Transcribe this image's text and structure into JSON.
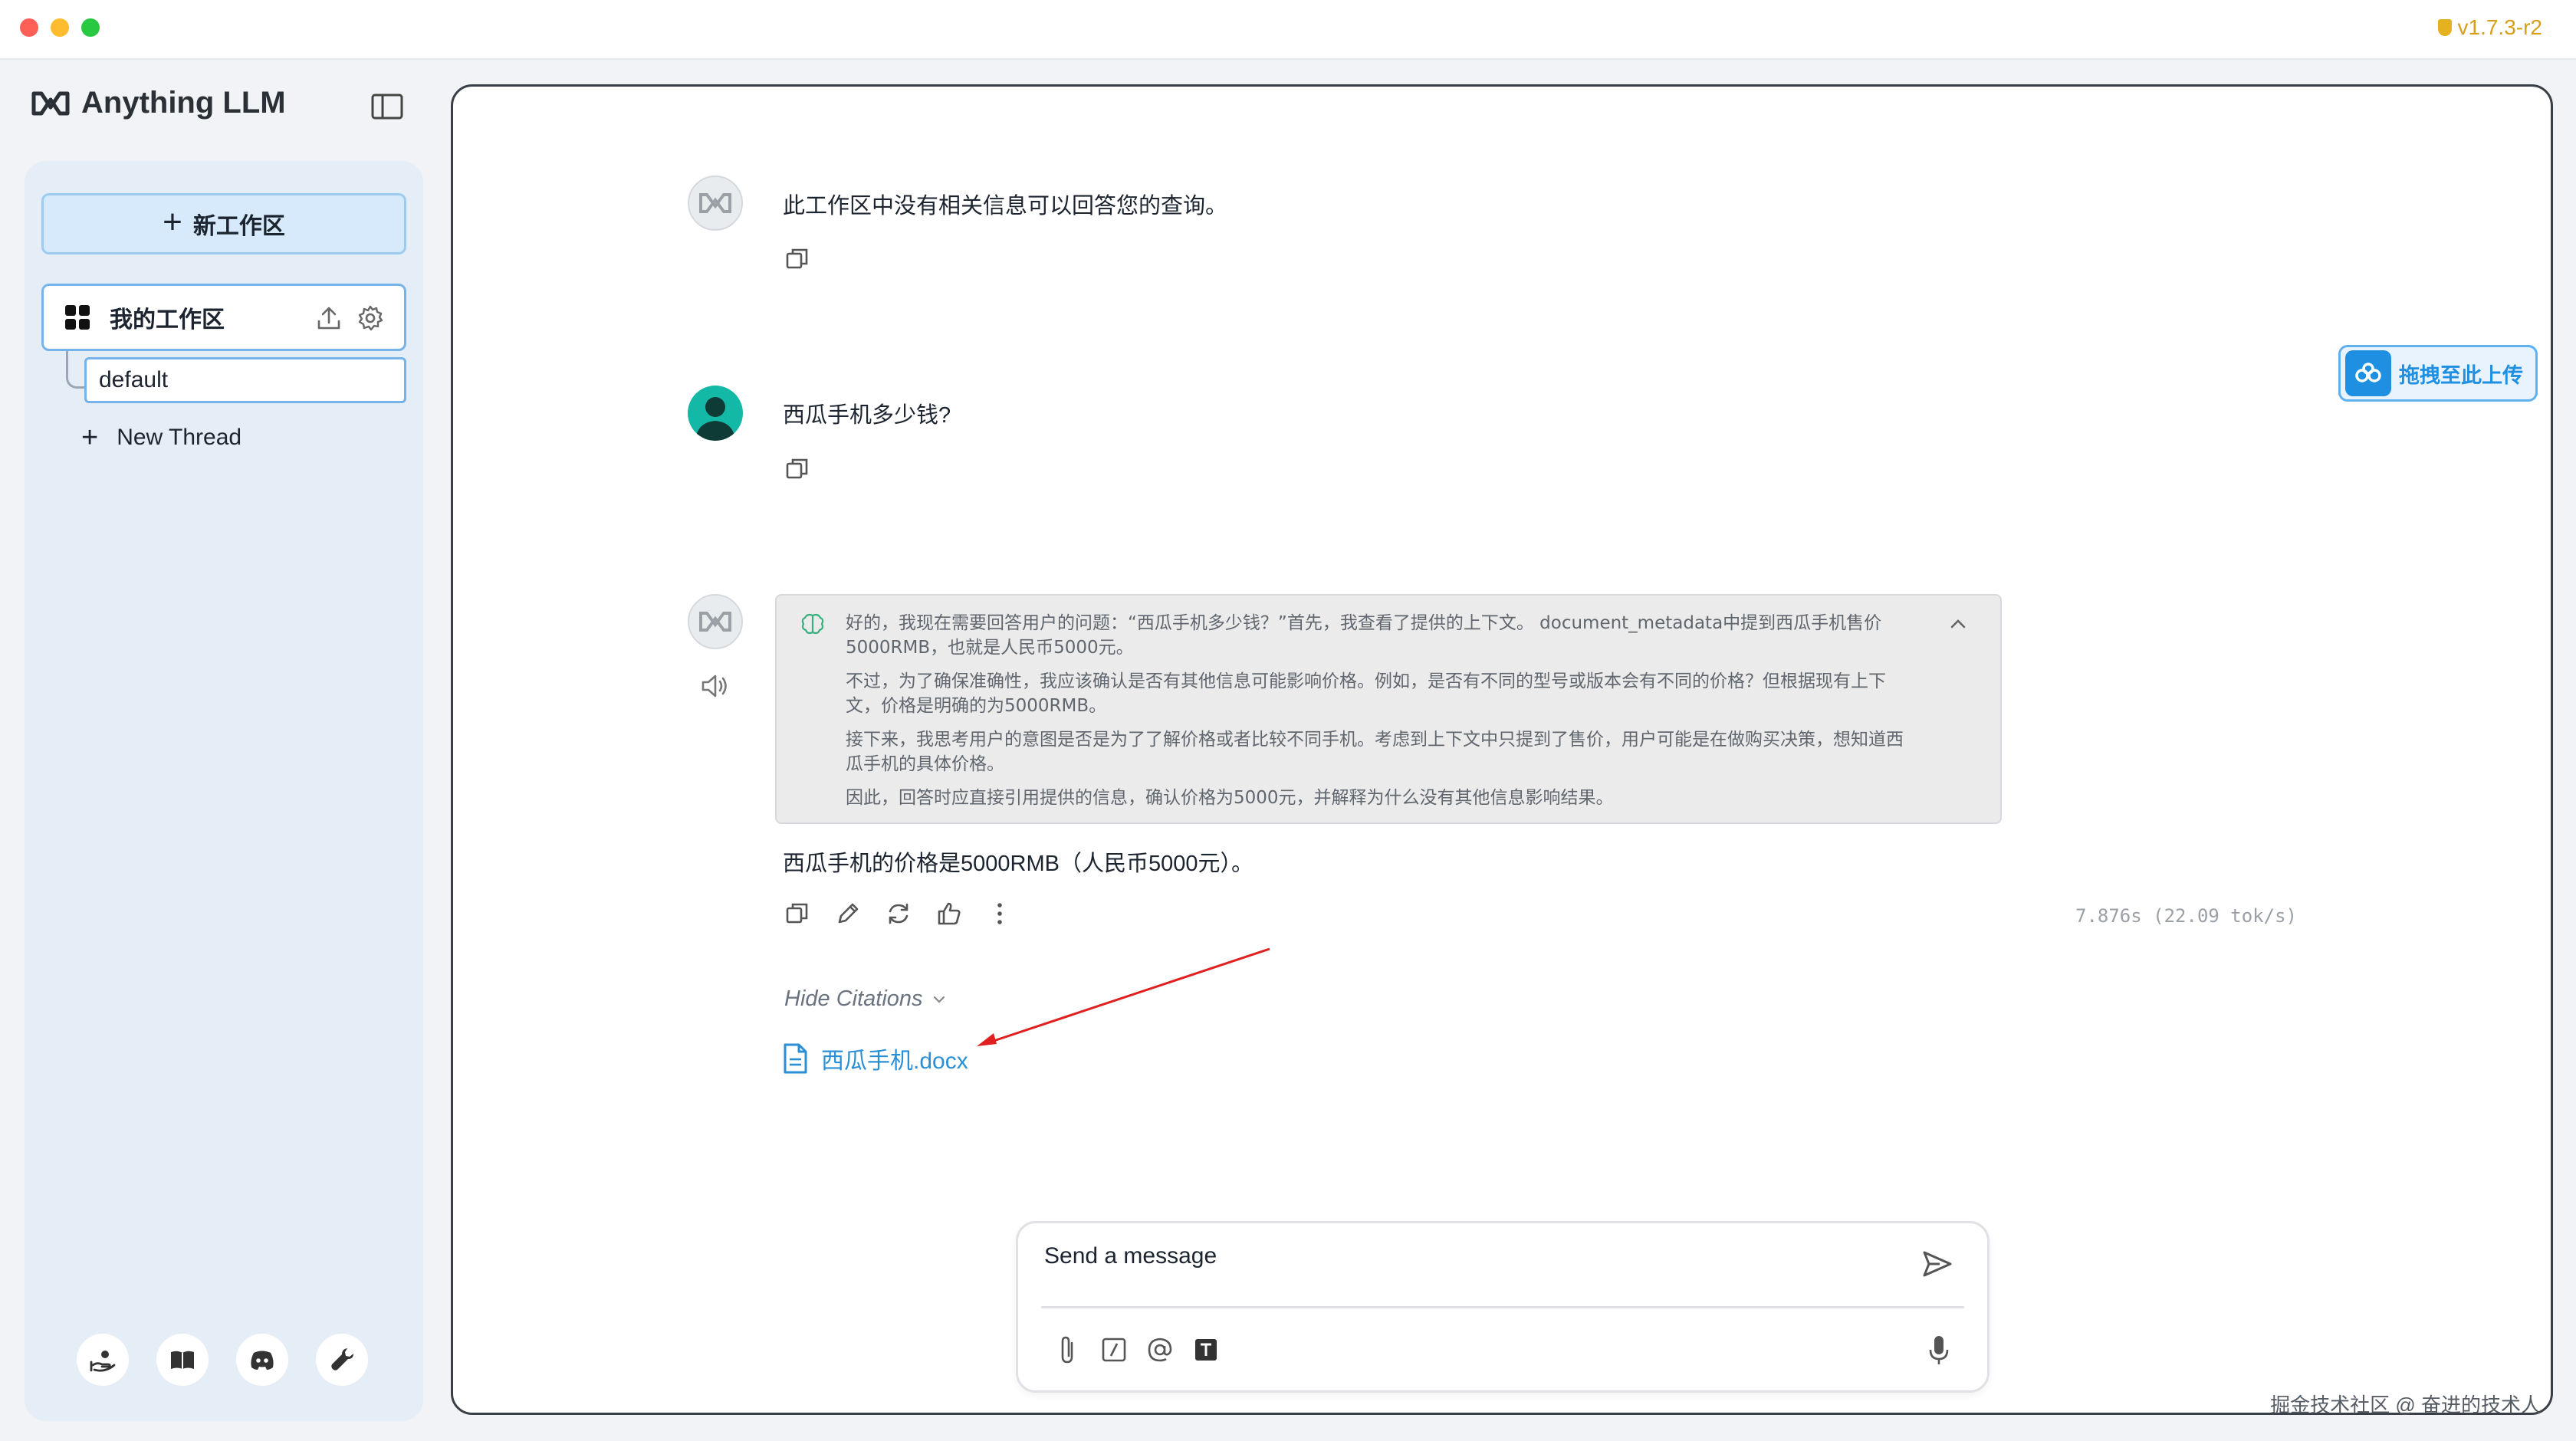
{
  "window": {
    "version": "v1.7.3-r2"
  },
  "sidebar": {
    "brand": "Anything LLM",
    "new_workspace_label": "新工作区",
    "workspace_name": "我的工作区",
    "thread_name": "default",
    "new_thread_label": "New Thread",
    "footer_icons": [
      "community-hub-icon",
      "docs-book-icon",
      "discord-icon",
      "settings-wrench-icon"
    ]
  },
  "chat": {
    "messages": [
      {
        "role": "assistant",
        "text": "此工作区中没有相关信息可以回答您的查询。"
      },
      {
        "role": "user",
        "text": "西瓜手机多少钱?"
      },
      {
        "role": "assistant",
        "thought": [
          "好的，我现在需要回答用户的问题：“西瓜手机多少钱？”首先，我查看了提供的上下文。 document_metadata中提到西瓜手机售价5000RMB，也就是人民币5000元。",
          "不过，为了确保准确性，我应该确认是否有其他信息可能影响价格。例如，是否有不同的型号或版本会有不同的价格？但根据现有上下文，价格是明确的为5000RMB。",
          "接下来，我思考用户的意图是否是为了了解价格或者比较不同手机。考虑到上下文中只提到了售价，用户可能是在做购买决策，想知道西瓜手机的具体价格。",
          "因此，回答时应直接引用提供的信息，确认价格为5000元，并解释为什么没有其他信息影响结果。"
        ],
        "text": "西瓜手机的价格是5000RMB（人民币5000元）。",
        "timing": "7.876s (22.09 tok/s)",
        "hide_citations_label": "Hide Citations",
        "citation_file": "西瓜手机.docx"
      }
    ]
  },
  "composer": {
    "placeholder": "Send a message"
  },
  "floating": {
    "upload_label": "拖拽至此上传"
  },
  "watermark": "掘金技术社区 @ 奋进的技术人",
  "colors": {
    "accent": "#2a8fd4",
    "annotation_arrow": "#e02020",
    "brand_mark": "#2b2f36"
  }
}
